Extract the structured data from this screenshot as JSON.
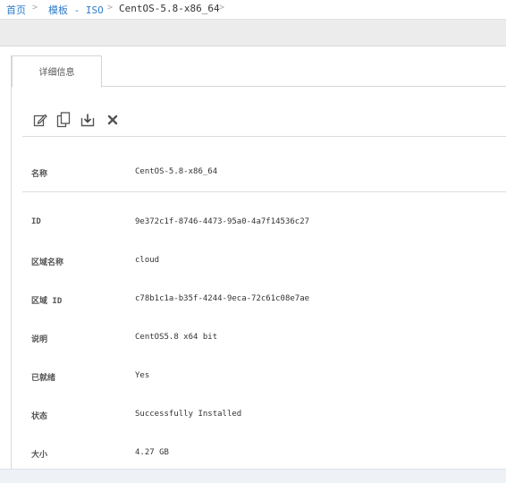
{
  "breadcrumb": {
    "home": "首页",
    "templates": "模板 - ISO",
    "current": "CentOS-5.8-x86_64",
    "separator": ">"
  },
  "tabs": [
    {
      "label": "详细信息",
      "active": true
    }
  ],
  "actions": [
    "edit-icon",
    "copy-icon",
    "download-icon",
    "delete-icon"
  ],
  "details": {
    "name": {
      "label": "名称",
      "value": "CentOS-5.8-x86_64"
    },
    "id": {
      "label": "ID",
      "value": "9e372c1f-8746-4473-95a0-4a7f14536c27"
    },
    "zone": {
      "label": "区域名称",
      "value": "cloud"
    },
    "zoneid": {
      "label": "区域 ID",
      "value": "c78b1c1a-b35f-4244-9eca-72c61c08e7ae"
    },
    "desc": {
      "label": "说明",
      "value": "CentOS5.8 x64 bit"
    },
    "ready": {
      "label": "已就绪",
      "value": "Yes"
    },
    "status": {
      "label": "状态",
      "value": "Successfully Installed"
    },
    "size": {
      "label": "大小",
      "value": "4.27 GB"
    }
  },
  "colors": {
    "link": "#2e7bc9",
    "band": "#ececec"
  }
}
